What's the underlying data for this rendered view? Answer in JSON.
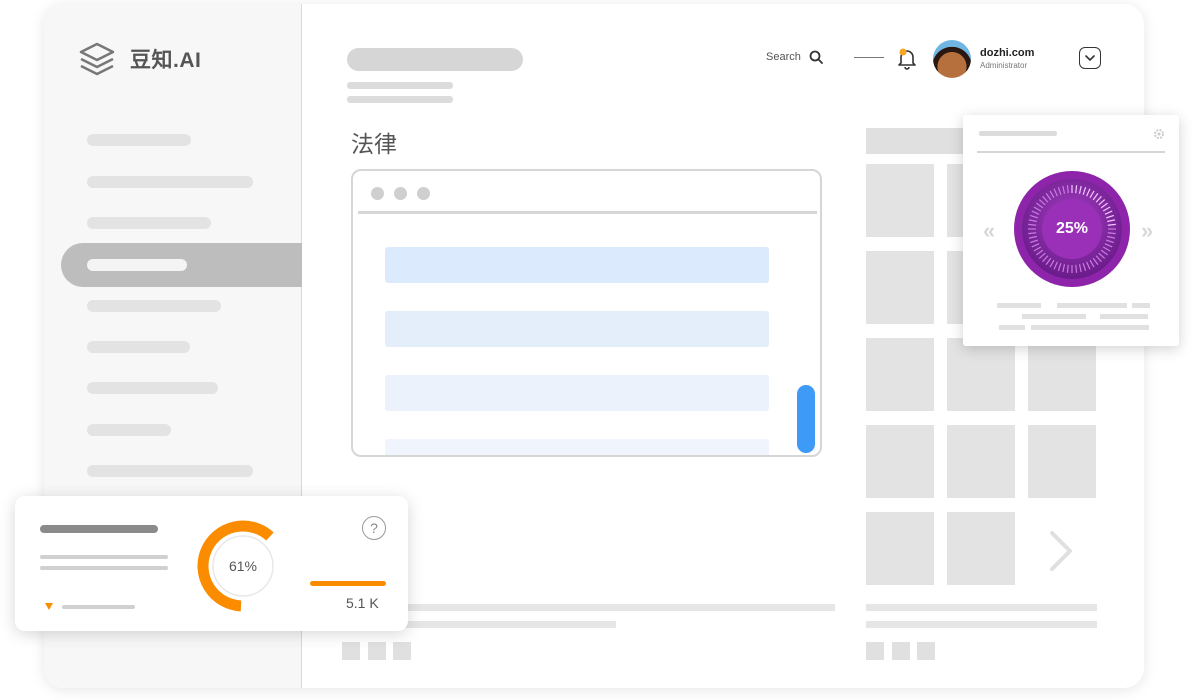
{
  "app": {
    "name": "豆知.AI"
  },
  "header": {
    "search_label": "Search",
    "user": {
      "name": "dozhi.com",
      "role": "Administrator"
    }
  },
  "main": {
    "page_title": "法律"
  },
  "dial_widget": {
    "value_text": "25%",
    "value": 0.25
  },
  "stats_widget": {
    "donut_text": "61%",
    "donut_value": 0.61,
    "value_text": "5.1 K",
    "help_label": "?"
  },
  "icons": {
    "logo": "layers-icon",
    "search": "search-icon",
    "notification": "bell-icon",
    "dropdown": "chevron-down-icon",
    "next": "chevron-right-icon",
    "settings": "gear-icon",
    "help": "help-icon"
  },
  "colors": {
    "accent_blue": "#3d9af7",
    "accent_orange": "#fb8c00",
    "accent_purple": "#8e24aa",
    "notification_dot": "#f5a623"
  }
}
